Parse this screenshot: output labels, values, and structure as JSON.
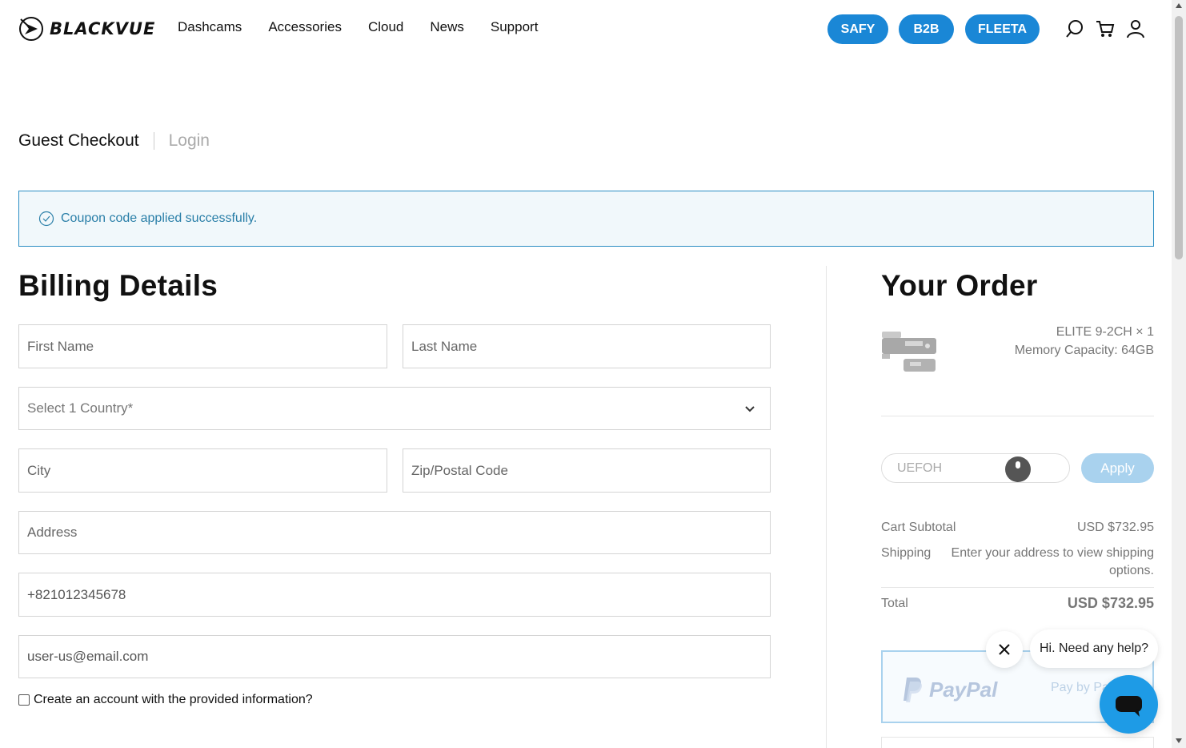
{
  "header": {
    "logo_text": "BLACKVUE",
    "nav": [
      "Dashcams",
      "Accessories",
      "Cloud",
      "News",
      "Support"
    ],
    "pills": [
      "SAFY",
      "B2B",
      "FLEETA"
    ],
    "icons": [
      "search-icon",
      "cart-icon",
      "user-icon"
    ],
    "accent": "#1a87d6"
  },
  "tabs": {
    "active": "Guest Checkout",
    "inactive": "Login"
  },
  "notice": {
    "text": "Coupon code applied successfully."
  },
  "billing": {
    "title": "Billing Details",
    "first_name_placeholder": "First Name",
    "last_name_placeholder": "Last Name",
    "country_placeholder": "Select 1 Country*",
    "city_placeholder": "City",
    "zip_placeholder": "Zip/Postal Code",
    "address_placeholder": "Address",
    "phone_value": "+821012345678",
    "email_value": "user-us@email.com",
    "create_account_label": "Create an account with the provided information?"
  },
  "order": {
    "title": "Your Order",
    "item_name": "ELITE 9-2CH × 1",
    "item_option": "Memory Capacity: 64GB",
    "coupon_value": "UEFOH",
    "apply_label": "Apply",
    "subtotal_label": "Cart Subtotal",
    "subtotal_value": "USD $732.95",
    "shipping_label": "Shipping",
    "shipping_note": "Enter your address to view shipping options.",
    "total_label": "Total",
    "total_value": "USD $732.95",
    "paypal_word": "PayPal",
    "paypal_payby": "Pay by Pa"
  },
  "chat": {
    "greeting": "Hi. Need any help?"
  }
}
